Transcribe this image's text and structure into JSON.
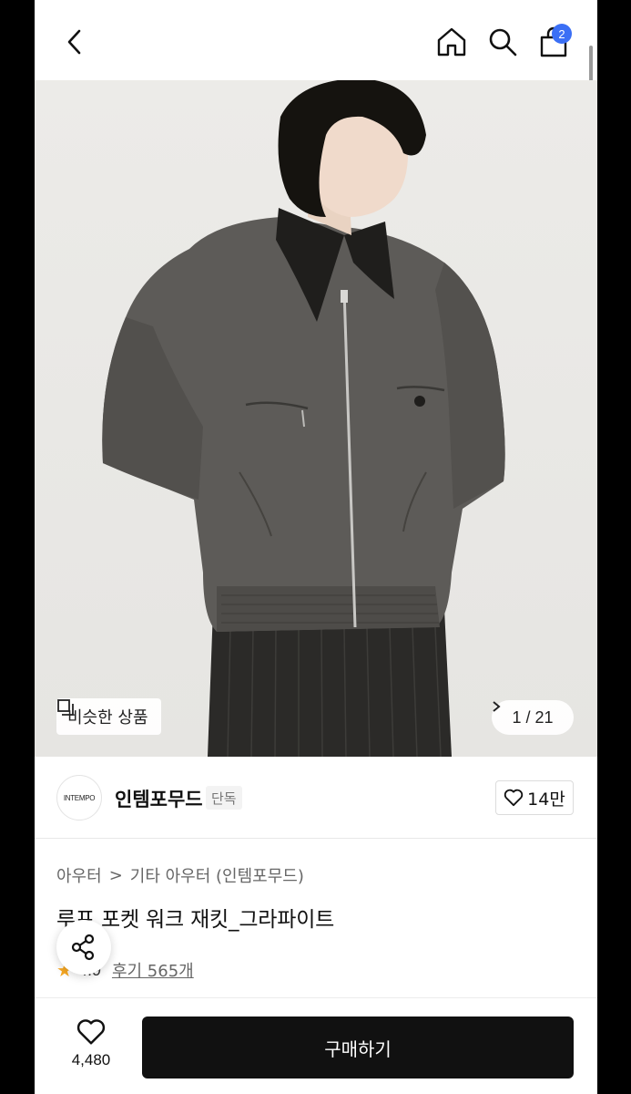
{
  "header": {
    "back_icon": "chevron-left-icon",
    "home_icon": "home-icon",
    "search_icon": "search-icon",
    "cart_icon": "shopping-bag-icon",
    "cart_badge": "2",
    "badge_color": "#3b6ff5"
  },
  "gallery": {
    "similar_label": "비슷한 상품",
    "counter_text": "1 / 21",
    "counter_icon": "chevron-right-icon"
  },
  "brand": {
    "logo_text": "INTEMPO",
    "name": "인템포무드",
    "exclusive_label": "단독",
    "like_count": "14만"
  },
  "breadcrumb": {
    "level1": "아우터",
    "separator": ">",
    "level2": "기타 아우터 (인템포무드)"
  },
  "product": {
    "title": "루프 포켓 워크 재킷_그라파이트",
    "rating": "4.9",
    "reviews": "후기 565개"
  },
  "bottom_bar": {
    "wish_count": "4,480",
    "buy_label": "구매하기"
  }
}
